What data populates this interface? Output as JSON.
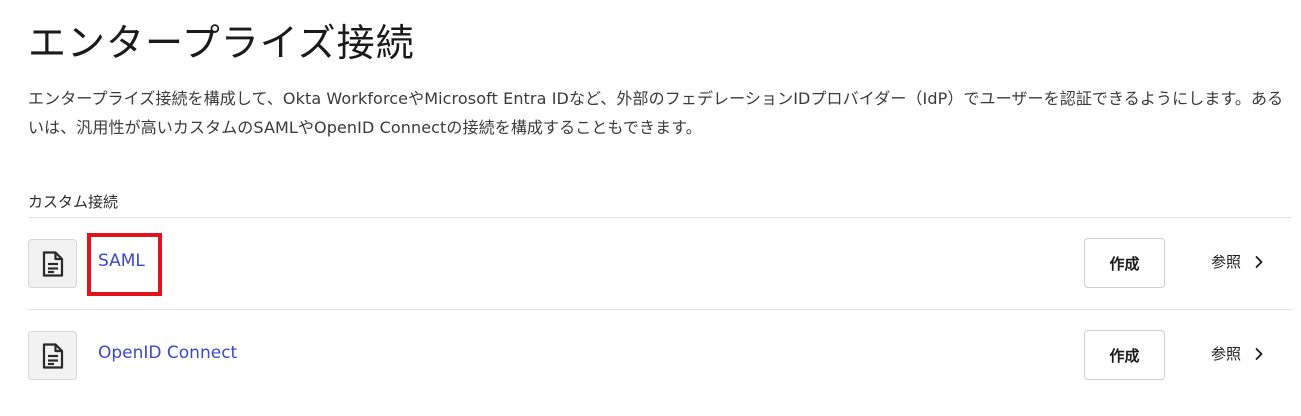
{
  "page": {
    "title": "エンタープライズ接続",
    "description": "エンタープライズ接続を構成して、Okta WorkforceやMicrosoft Entra IDなど、外部のフェデレーションIDプロバイダー（IdP）でユーザーを認証できるようにします。あるいは、汎用性が高いカスタムのSAMLやOpenID Connectの接続を構成することもできます。"
  },
  "custom_connections": {
    "section_label": "カスタム接続",
    "items": [
      {
        "name": "SAML",
        "icon": "document-icon",
        "create_label": "作成",
        "ref_label": "参照",
        "highlighted": true
      },
      {
        "name": "OpenID Connect",
        "icon": "document-icon",
        "create_label": "作成",
        "ref_label": "参照",
        "highlighted": false
      }
    ]
  },
  "colors": {
    "link": "#3b49c6",
    "highlight": "#e2131b",
    "divider": "#e3e3e3"
  }
}
